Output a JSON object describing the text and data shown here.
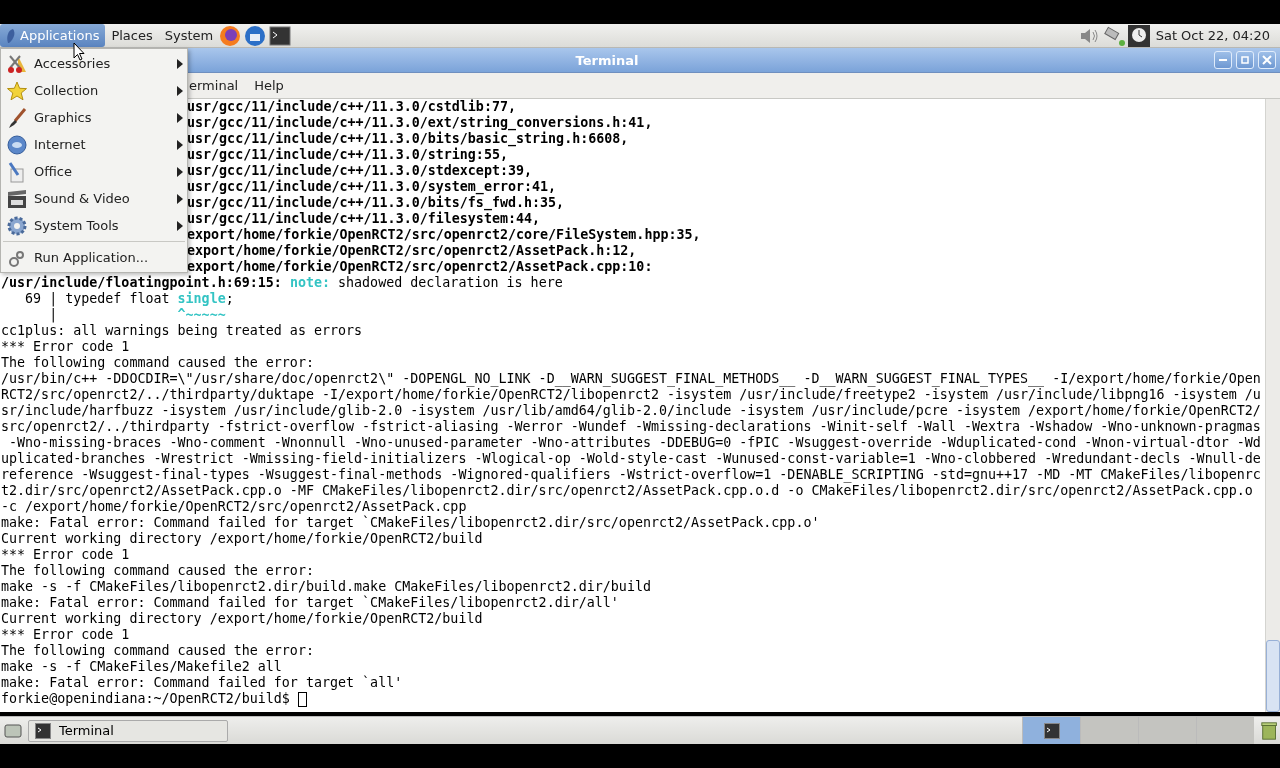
{
  "top_panel": {
    "menus": [
      {
        "label": "Applications",
        "selected": true
      },
      {
        "label": "Places",
        "selected": false
      },
      {
        "label": "System",
        "selected": false
      }
    ],
    "clock": "Sat Oct 22, 04:20"
  },
  "window": {
    "title": "Terminal",
    "menubar": [
      "erminal",
      "Help"
    ],
    "lines": [
      [
        {
          "t": "usr/gcc/11/include/c++/11.3.0/cstdlib:77,",
          "kind": "bold"
        }
      ],
      [
        {
          "t": "usr/gcc/11/include/c++/11.3.0/ext/string_conversions.h:41,",
          "kind": "bold"
        }
      ],
      [
        {
          "t": "usr/gcc/11/include/c++/11.3.0/bits/basic_string.h:6608,",
          "kind": "bold"
        }
      ],
      [
        {
          "t": "usr/gcc/11/include/c++/11.3.0/string:55,",
          "kind": "bold"
        }
      ],
      [
        {
          "t": "usr/gcc/11/include/c++/11.3.0/stdexcept:39,",
          "kind": "bold"
        }
      ],
      [
        {
          "t": "usr/gcc/11/include/c++/11.3.0/system_error:41,",
          "kind": "bold"
        }
      ],
      [
        {
          "t": "usr/gcc/11/include/c++/11.3.0/bits/fs_fwd.h:35,",
          "kind": "bold"
        }
      ],
      [
        {
          "t": "usr/gcc/11/include/c++/11.3.0/filesystem:44,",
          "kind": "bold"
        }
      ],
      [
        {
          "t": "export/home/forkie/OpenRCT2/src/openrct2/core/FileSystem.hpp:35,",
          "kind": "bold"
        }
      ],
      [
        {
          "t": "export/home/forkie/OpenRCT2/src/openrct2/AssetPack.h:12,",
          "kind": "bold"
        }
      ],
      [
        {
          "t": "export/home/forkie/OpenRCT2/src/openrct2/AssetPack.cpp:10:",
          "kind": "bold"
        }
      ],
      [
        {
          "t": "/usr/include/floatingpoint.h:69:15: ",
          "kind": "bold"
        },
        {
          "t": "note:",
          "kind": "note"
        },
        {
          "t": " shadowed declaration is here",
          "kind": "plain"
        }
      ],
      [
        {
          "t": "   69 | typedef float ",
          "kind": "plain"
        },
        {
          "t": "single",
          "kind": "hl"
        },
        {
          "t": ";",
          "kind": "plain"
        }
      ],
      [
        {
          "t": "      |               ",
          "kind": "plain"
        },
        {
          "t": "^~~~~~",
          "kind": "hl"
        }
      ],
      [
        {
          "t": "cc1plus: all warnings being treated as errors",
          "kind": "plain"
        }
      ],
      [
        {
          "t": "*** Error code 1",
          "kind": "plain"
        }
      ],
      [
        {
          "t": "The following command caused the error:",
          "kind": "plain"
        }
      ],
      [
        {
          "t": "/usr/bin/c++ -DDOCDIR=\\\"/usr/share/doc/openrct2\\\" -DOPENGL_NO_LINK -D__WARN_SUGGEST_FINAL_METHODS__ -D__WARN_SUGGEST_FINAL_TYPES__ -I/export/home/forkie/Open",
          "kind": "plain"
        }
      ],
      [
        {
          "t": "RCT2/src/openrct2/../thirdparty/duktape -I/export/home/forkie/OpenRCT2/libopenrct2 -isystem /usr/include/freetype2 -isystem /usr/include/libpng16 -isystem /u",
          "kind": "plain"
        }
      ],
      [
        {
          "t": "sr/include/harfbuzz -isystem /usr/include/glib-2.0 -isystem /usr/lib/amd64/glib-2.0/include -isystem /usr/include/pcre -isystem /export/home/forkie/OpenRCT2/",
          "kind": "plain"
        }
      ],
      [
        {
          "t": "src/openrct2/../thirdparty -fstrict-overflow -fstrict-aliasing -Werror -Wundef -Wmissing-declarations -Winit-self -Wall -Wextra -Wshadow -Wno-unknown-pragmas",
          "kind": "plain"
        }
      ],
      [
        {
          "t": " -Wno-missing-braces -Wno-comment -Wnonnull -Wno-unused-parameter -Wno-attributes -DDEBUG=0 -fPIC -Wsuggest-override -Wduplicated-cond -Wnon-virtual-dtor -Wd",
          "kind": "plain"
        }
      ],
      [
        {
          "t": "uplicated-branches -Wrestrict -Wmissing-field-initializers -Wlogical-op -Wold-style-cast -Wunused-const-variable=1 -Wno-clobbered -Wredundant-decls -Wnull-de",
          "kind": "plain"
        }
      ],
      [
        {
          "t": "reference -Wsuggest-final-types -Wsuggest-final-methods -Wignored-qualifiers -Wstrict-overflow=1 -DENABLE_SCRIPTING -std=gnu++17 -MD -MT CMakeFiles/libopenrc",
          "kind": "plain"
        }
      ],
      [
        {
          "t": "t2.dir/src/openrct2/AssetPack.cpp.o -MF CMakeFiles/libopenrct2.dir/src/openrct2/AssetPack.cpp.o.d -o CMakeFiles/libopenrct2.dir/src/openrct2/AssetPack.cpp.o",
          "kind": "plain"
        }
      ],
      [
        {
          "t": "-c /export/home/forkie/OpenRCT2/src/openrct2/AssetPack.cpp",
          "kind": "plain"
        }
      ],
      [
        {
          "t": "make: Fatal error: Command failed for target `CMakeFiles/libopenrct2.dir/src/openrct2/AssetPack.cpp.o'",
          "kind": "plain"
        }
      ],
      [
        {
          "t": "Current working directory /export/home/forkie/OpenRCT2/build",
          "kind": "plain"
        }
      ],
      [
        {
          "t": "*** Error code 1",
          "kind": "plain"
        }
      ],
      [
        {
          "t": "The following command caused the error:",
          "kind": "plain"
        }
      ],
      [
        {
          "t": "make -s -f CMakeFiles/libopenrct2.dir/build.make CMakeFiles/libopenrct2.dir/build",
          "kind": "plain"
        }
      ],
      [
        {
          "t": "make: Fatal error: Command failed for target `CMakeFiles/libopenrct2.dir/all'",
          "kind": "plain"
        }
      ],
      [
        {
          "t": "Current working directory /export/home/forkie/OpenRCT2/build",
          "kind": "plain"
        }
      ],
      [
        {
          "t": "*** Error code 1",
          "kind": "plain"
        }
      ],
      [
        {
          "t": "The following command caused the error:",
          "kind": "plain"
        }
      ],
      [
        {
          "t": "make -s -f CMakeFiles/Makefile2 all",
          "kind": "plain"
        }
      ],
      [
        {
          "t": "make: Fatal error: Command failed for target `all'",
          "kind": "plain"
        }
      ],
      [
        {
          "t": "forkie@openindiana:~/OpenRCT2/build$ ",
          "kind": "plain"
        }
      ]
    ],
    "prompt_cursor": true
  },
  "apps_menu": [
    {
      "label": "Accessories",
      "kind": "submenu"
    },
    {
      "label": "Collection",
      "kind": "submenu"
    },
    {
      "label": "Graphics",
      "kind": "submenu"
    },
    {
      "label": "Internet",
      "kind": "submenu"
    },
    {
      "label": "Office",
      "kind": "submenu"
    },
    {
      "label": "Sound & Video",
      "kind": "submenu"
    },
    {
      "label": "System Tools",
      "kind": "submenu"
    },
    {
      "label": "Run Application...",
      "kind": "action"
    }
  ],
  "taskbar": {
    "tasks": [
      {
        "label": "Terminal",
        "selected": false
      }
    ],
    "workspaces": [
      {
        "selected": true
      },
      {
        "selected": false
      },
      {
        "selected": false
      },
      {
        "selected": false
      }
    ]
  }
}
